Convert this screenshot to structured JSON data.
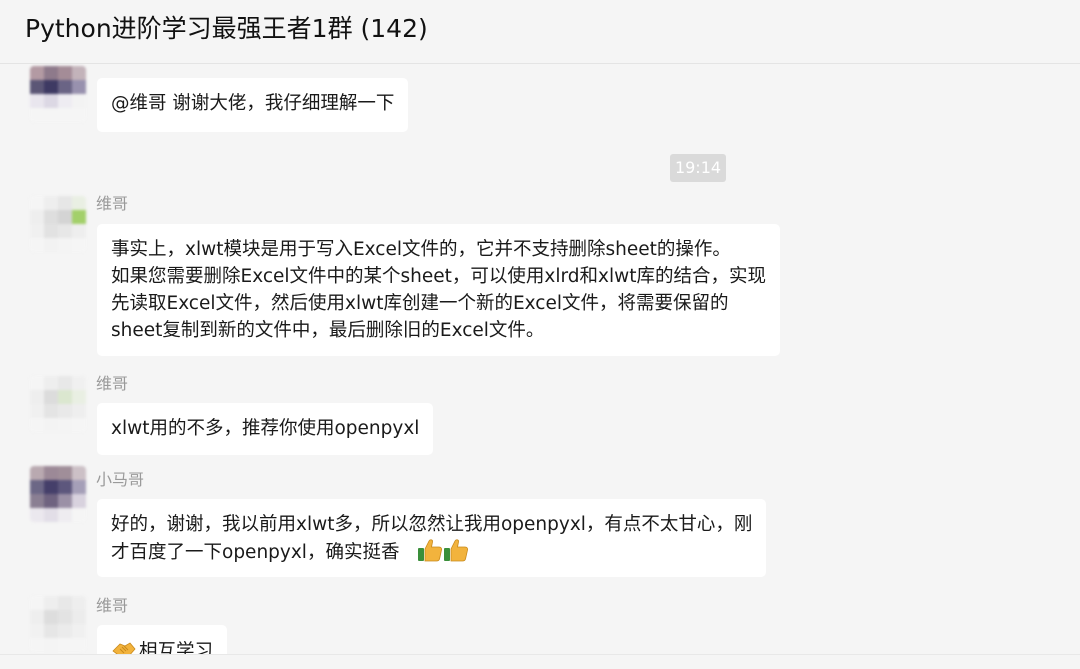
{
  "window": {
    "title": "Python进阶学习最强王者1群 (142)"
  },
  "chat": {
    "time_separator": "19:14",
    "messages": [
      {
        "sender": "",
        "lines": [
          "@维哥  谢谢大佬，我仔细理解一下"
        ]
      },
      {
        "sender": "维哥",
        "lines": [
          "事实上，xlwt模块是用于写入Excel文件的，它并不支持删除sheet的操作。",
          "如果您需要删除Excel文件中的某个sheet，可以使用xlrd和xlwt库的结合，实现",
          "先读取Excel文件，然后使用xlwt库创建一个新的Excel文件，将需要保留的",
          "sheet复制到新的文件中，最后删除旧的Excel文件。"
        ]
      },
      {
        "sender": "维哥",
        "lines": [
          "xlwt用的不多，推荐你使用openpyxl"
        ]
      },
      {
        "sender": "小马哥",
        "lines": [
          "好的，谢谢，我以前用xlwt多，所以忽然让我用openpyxl，有点不太甘心，刚",
          "才百度了一下openpyxl，确实挺香"
        ],
        "emoji": [
          "thumbs-up-icon",
          "thumbs-up-icon"
        ]
      },
      {
        "sender": "维哥",
        "lines": [
          "相互学习"
        ],
        "emoji_prefix": "handshake-icon"
      }
    ]
  },
  "colors": {
    "background": "#f5f5f5",
    "bubble": "#ffffff",
    "sender_name": "#9a9a9a",
    "time_pill": "#dadada",
    "thumb": "#f2b33d"
  }
}
